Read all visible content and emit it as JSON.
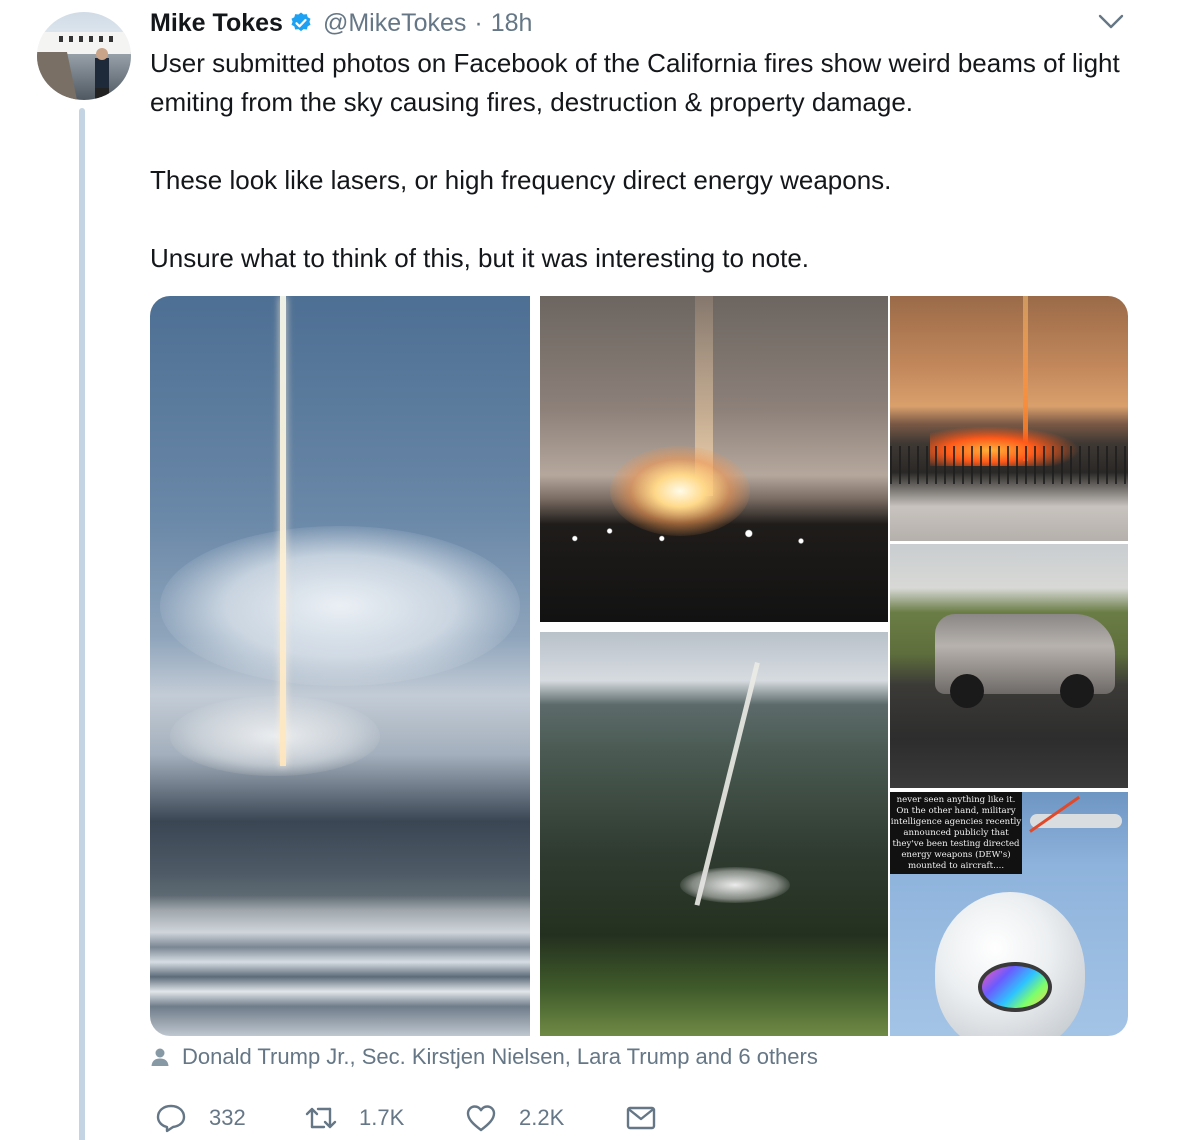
{
  "tweet": {
    "display_name": "Mike Tokes",
    "handle": "@MikeTokes",
    "separator": "·",
    "time": "18h",
    "verified": true,
    "paragraphs": [
      "User submitted photos on Facebook of the California fires show weird beams of light emiting from the sky causing fires, destruction & property damage.",
      "These look like lasers, or high frequency direct energy weapons.",
      "Unsure what to think of this, but it was interesting to note."
    ],
    "image_caption": "never seen anything like it. On the other hand, military intelligence agencies recently announced publicly that they've been testing directed energy weapons (DEW's) mounted to aircraft....",
    "liked_by": "Donald Trump Jr., Sec. Kirstjen Nielsen, Lara Trump and 6 others",
    "counts": {
      "replies": "332",
      "retweets": "1.7K",
      "likes": "2.2K"
    }
  },
  "icons": {
    "verified": "verified-badge-icon",
    "caret": "chevron-down-icon",
    "liked_by": "person-icon",
    "reply": "reply-icon",
    "retweet": "retweet-icon",
    "like": "heart-icon",
    "message": "envelope-icon"
  },
  "colors": {
    "text": "#14171a",
    "secondary": "#657786",
    "verified": "#1da1f2",
    "thread_line": "#c4d4e2"
  }
}
